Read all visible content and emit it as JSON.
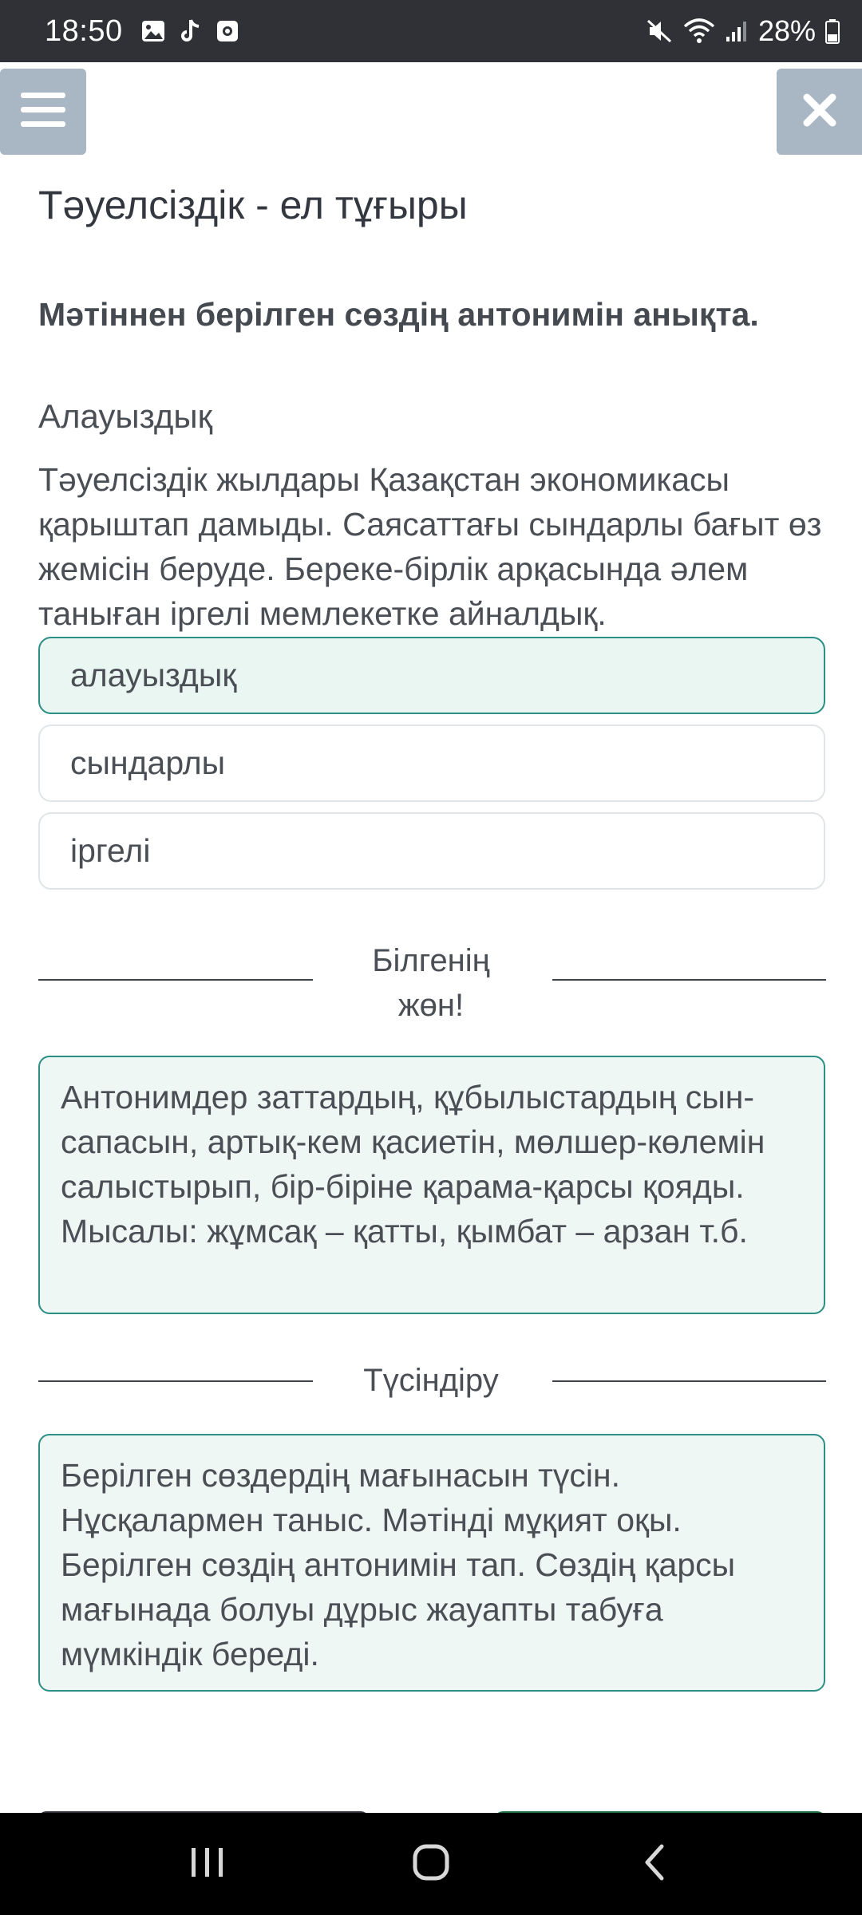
{
  "status_bar": {
    "time": "18:50",
    "battery": "28%",
    "left_icons": [
      "gallery-icon",
      "tiktok-icon",
      "screen-record-icon"
    ],
    "right_icons": [
      "mute-icon",
      "wifi-icon",
      "signal-icon",
      "battery-icon"
    ]
  },
  "header": {
    "menu_icon": "hamburger-icon",
    "close_icon": "close-icon"
  },
  "page": {
    "title": "Тәуелсіздік - ел тұғыры"
  },
  "question": {
    "prompt": "Мәтіннен берілген сөздің антонимін анықта.",
    "word": "Алауыздық",
    "passage": "Тәуелсіздік жылдары Қазақстан экономикасы қарыштап дамыды. Саясаттағы сындарлы бағыт өз жемісін беруде. Береке-бірлік арқасында әлем таныған іргелі мемлекетке айналдық.",
    "options": [
      {
        "label": "алауыздық",
        "selected": true
      },
      {
        "label": "сындарлы",
        "selected": false
      },
      {
        "label": "іргелі",
        "selected": false
      }
    ]
  },
  "sections": {
    "good_to_know": {
      "label": "Білгенің жөн!",
      "text": "Антонимдер заттардың, құбылыстардың сын-сапасын, артық-кем қасиетін, мөлшер-көлемін салыстырып, бір-біріне қарама-қарсы қояды. Мысалы: жұмсақ – қатты, қымбат – арзан т.б."
    },
    "explanation": {
      "label": "Түсіндіру",
      "text": "Берілген сөздердің мағынасын түсін. Нұсқалармен таныс. Мәтінді мұқият оқы. Берілген сөздің антонимін тап. Сөздің қарсы мағынада болуы дұрыс жауапты табуға мүмкіндік береді."
    }
  },
  "nav_bar": {
    "icons": [
      "recent-apps-icon",
      "home-icon",
      "back-icon"
    ]
  },
  "colors": {
    "status_bar_bg": "#2f3136",
    "header_button_bg": "#a9b6c3",
    "accent_teal": "#2b8f86",
    "selected_bg": "#eaf6f1",
    "info_bg": "#eef7f3",
    "nav_bar_bg": "#000000"
  }
}
